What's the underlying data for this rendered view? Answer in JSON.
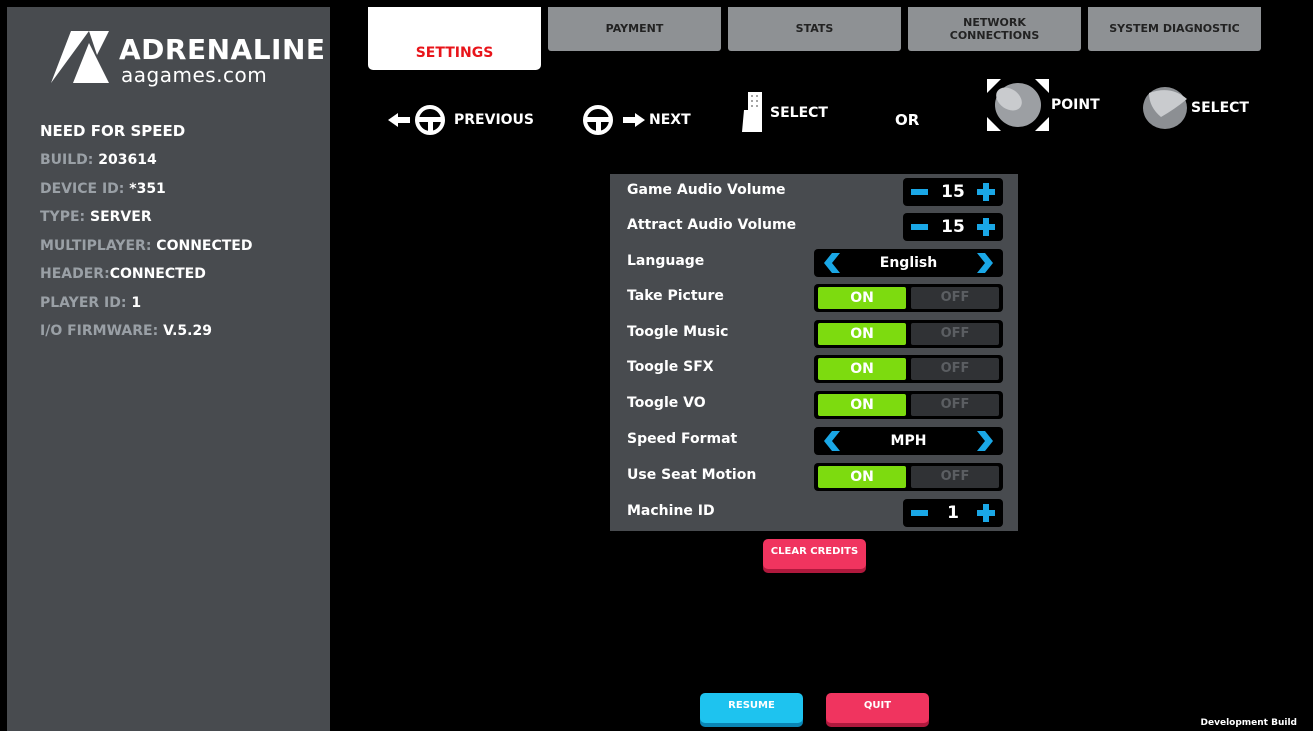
{
  "logo": {
    "main": "ADRENALINE",
    "sub": "aagames.com"
  },
  "sidebar": {
    "title": "NEED FOR SPEED",
    "items": [
      {
        "key": "BUILD:",
        "value": "203614"
      },
      {
        "key": "DEVICE ID:",
        "value": "*351"
      },
      {
        "key": "TYPE:",
        "value": "SERVER"
      },
      {
        "key": "MULTIPLAYER:",
        "value": "CONNECTED"
      },
      {
        "key": "HEADER:",
        "value": "CONNECTED"
      },
      {
        "key": "PLAYER ID:",
        "value": "1"
      },
      {
        "key": "I/O FIRMWARE:",
        "value": "V.5.29"
      }
    ]
  },
  "tabs": [
    {
      "label": "SETTINGS",
      "active": true
    },
    {
      "label": "PAYMENT"
    },
    {
      "label": "STATS"
    },
    {
      "label_line1": "NETWORK",
      "label_line2": "CONNECTIONS"
    },
    {
      "label": "SYSTEM DIAGNOSTIC"
    }
  ],
  "hints": {
    "previous": "PREVIOUS",
    "next": "NEXT",
    "select1": "SELECT",
    "or": "OR",
    "point": "POINT",
    "select2": "SELECT"
  },
  "settings": {
    "game_audio": {
      "label": "Game Audio Volume",
      "value": "15"
    },
    "attract_audio": {
      "label": "Attract Audio Volume",
      "value": "15"
    },
    "language": {
      "label": "Language",
      "value": "English"
    },
    "take_picture": {
      "label": "Take Picture",
      "on": "ON",
      "off": "OFF"
    },
    "toggle_music": {
      "label": "Toogle Music",
      "on": "ON",
      "off": "OFF"
    },
    "toggle_sfx": {
      "label": "Toogle SFX",
      "on": "ON",
      "off": "OFF"
    },
    "toggle_vo": {
      "label": "Toogle VO",
      "on": "ON",
      "off": "OFF"
    },
    "speed_format": {
      "label": "Speed Format",
      "value": "MPH"
    },
    "seat_motion": {
      "label": "Use Seat Motion",
      "on": "ON",
      "off": "OFF"
    },
    "machine_id": {
      "label": "Machine ID",
      "value": "1"
    }
  },
  "buttons": {
    "clear_credits": "CLEAR CREDITS",
    "resume": "RESUME",
    "quit": "QUIT"
  },
  "footer": {
    "dev_build": "Development Build"
  },
  "colors": {
    "panel": "#484b4f",
    "accent_blue": "#1aa7e6",
    "toggle_on": "#7ddb0f",
    "tab_active_text": "#e8141a",
    "button_red": "#f0345f",
    "button_blue": "#1ec3ef"
  }
}
